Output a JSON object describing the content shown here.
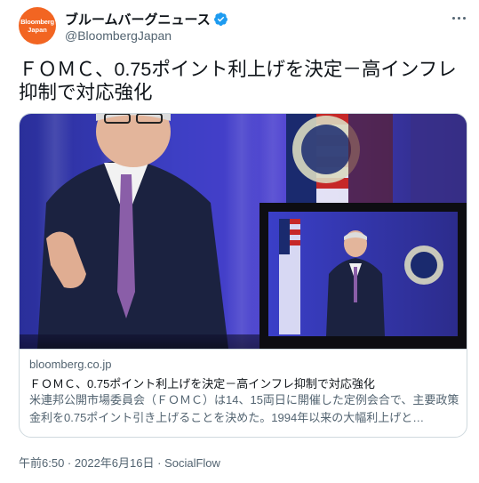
{
  "tweet": {
    "avatar_line1": "Bloomberg",
    "avatar_line2": "Japan",
    "display_name": "ブルームバーグニュース",
    "handle": "@BloombergJapan",
    "text": "ＦＯＭＣ、0.75ポイント利上げを決定－高インフレ抑制で対応強化"
  },
  "card": {
    "domain": "bloomberg.co.jp",
    "title": "ＦＯＭＣ、0.75ポイント利上げを決定－高インフレ抑制で対応強化",
    "description": "米連邦公開市場委員会（ＦＯＭＣ）は14、15両日に開催した定例会合で、主要政策金利を0.75ポイント引き上げることを決めた。1994年以来の大幅利上げと…"
  },
  "meta": {
    "time": "午前6:50",
    "separator1": " · ",
    "date": "2022年6月16日",
    "separator2": " · ",
    "source": "SocialFlow"
  },
  "colors": {
    "accent": "#1d9bf0",
    "avatar_bg": "#f26522",
    "secondary_text": "#536471",
    "border": "#cfd9de"
  },
  "icons": {
    "verified": "verified-badge-icon",
    "more": "more-options-icon"
  }
}
